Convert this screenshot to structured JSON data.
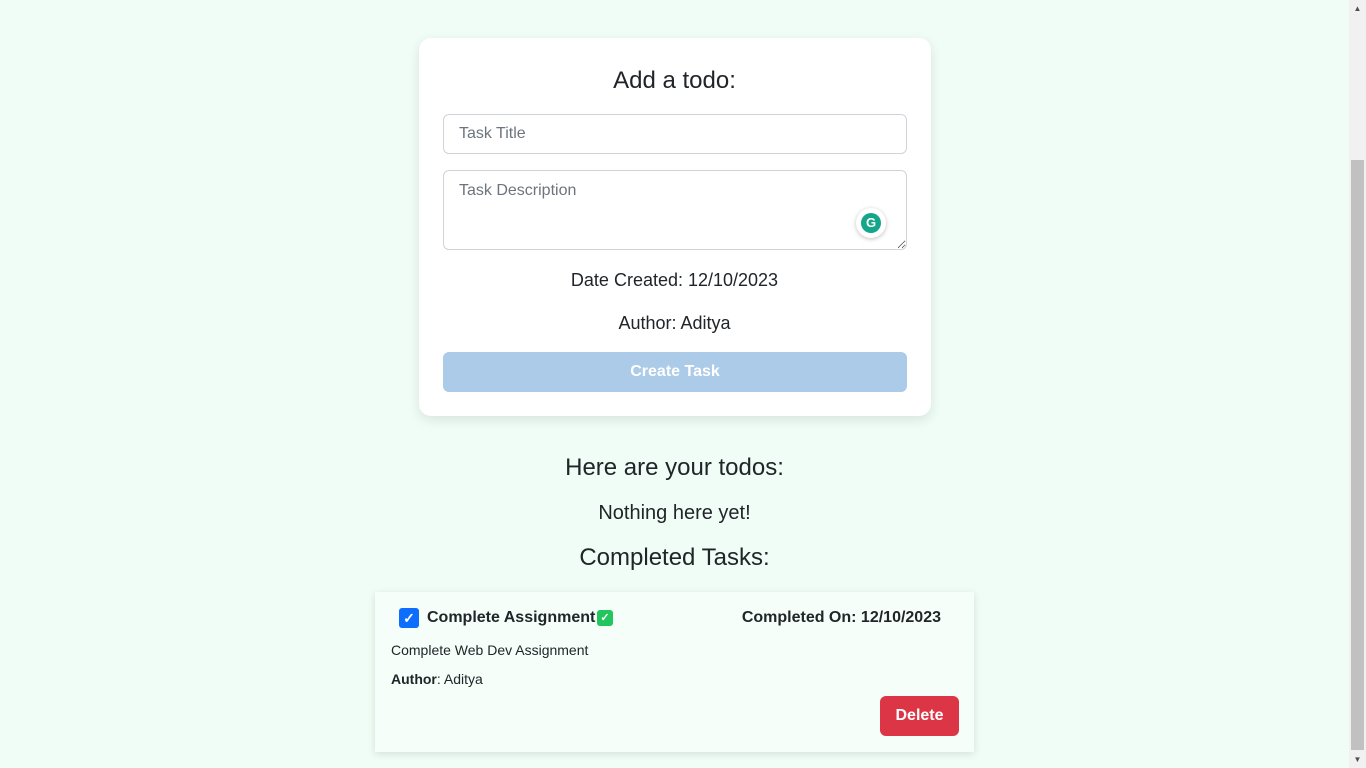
{
  "form": {
    "heading": "Add a todo:",
    "title_placeholder": "Task Title",
    "description_placeholder": "Task Description",
    "date_label": "Date Created: 12/10/2023",
    "author_label": "Author: Aditya",
    "create_button": "Create Task"
  },
  "grammarly": {
    "letter": "G"
  },
  "todos": {
    "heading": "Here are your todos:",
    "empty_message": "Nothing here yet!"
  },
  "completed": {
    "heading": "Completed Tasks:",
    "tasks": [
      {
        "checked": true,
        "check_glyph": "✓",
        "title": "Complete Assignment",
        "badge_glyph": "✓",
        "completed_on": "Completed On: 12/10/2023",
        "description": "Complete Web Dev Assignment",
        "author_label": "Author",
        "author_value": ": Aditya",
        "delete_button": "Delete"
      }
    ]
  },
  "scrollbar": {
    "up_glyph": "▲",
    "down_glyph": "▼"
  },
  "colors": {
    "background": "#f0fdf6",
    "create_button": "#abcbe8",
    "delete_button": "#dc3545",
    "checkbox": "#0d6efd",
    "done_badge": "#22c55e",
    "grammarly": "#15a689"
  }
}
